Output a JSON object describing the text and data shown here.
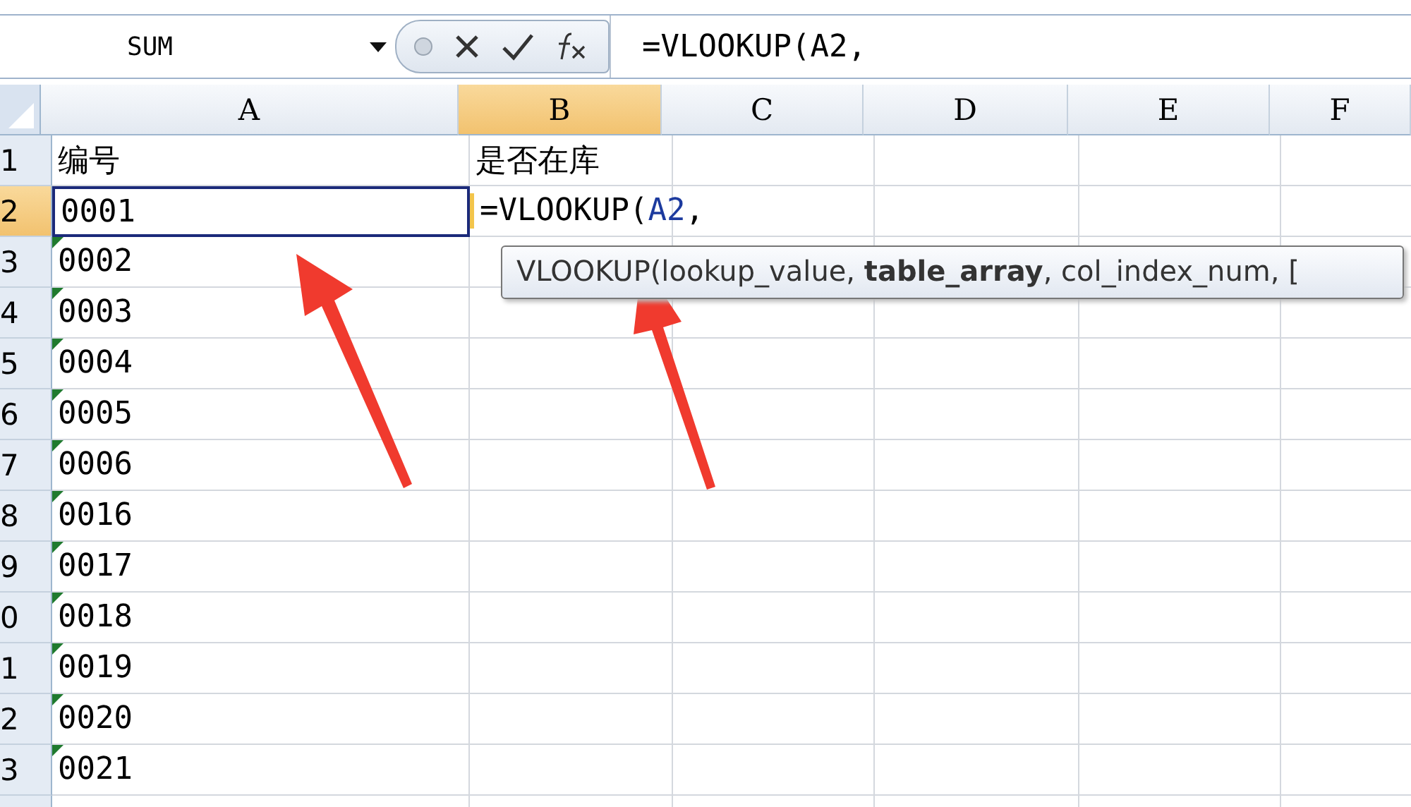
{
  "formula_bar": {
    "name_box": "SUM",
    "formula": "=VLOOKUP(A2,"
  },
  "columns": [
    {
      "label": "A",
      "selected": false
    },
    {
      "label": "B",
      "selected": true
    },
    {
      "label": "C",
      "selected": false
    },
    {
      "label": "D",
      "selected": false
    },
    {
      "label": "E",
      "selected": false
    },
    {
      "label": "F",
      "selected": false
    }
  ],
  "rows": [
    {
      "label": "1",
      "selected": false,
      "a_text": "编号",
      "a_flag": false,
      "a_referenced": false,
      "b_text": "是否在库"
    },
    {
      "label": "2",
      "selected": true,
      "a_text": "0001",
      "a_flag": false,
      "a_referenced": true,
      "b_edit": [
        {
          "text": "=VLOOKUP(",
          "kind": "plain"
        },
        {
          "text": "A2",
          "kind": "reference"
        },
        {
          "text": ",",
          "kind": "plain"
        }
      ]
    },
    {
      "label": "3",
      "selected": false,
      "a_text": "0002",
      "a_flag": true,
      "a_referenced": false
    },
    {
      "label": "4",
      "selected": false,
      "a_text": "0003",
      "a_flag": true,
      "a_referenced": false
    },
    {
      "label": "5",
      "selected": false,
      "a_text": "0004",
      "a_flag": true,
      "a_referenced": false
    },
    {
      "label": "6",
      "selected": false,
      "a_text": "0005",
      "a_flag": true,
      "a_referenced": false
    },
    {
      "label": "7",
      "selected": false,
      "a_text": "0006",
      "a_flag": true,
      "a_referenced": false
    },
    {
      "label": "8",
      "selected": false,
      "a_text": "0016",
      "a_flag": true,
      "a_referenced": false
    },
    {
      "label": "9",
      "selected": false,
      "a_text": "0017",
      "a_flag": true,
      "a_referenced": false
    },
    {
      "label": "0",
      "selected": false,
      "a_text": "0018",
      "a_flag": true,
      "a_referenced": false
    },
    {
      "label": "1",
      "selected": false,
      "a_text": "0019",
      "a_flag": true,
      "a_referenced": false
    },
    {
      "label": "2",
      "selected": false,
      "a_text": "0020",
      "a_flag": true,
      "a_referenced": false
    },
    {
      "label": "3",
      "selected": false,
      "a_text": "0021",
      "a_flag": true,
      "a_referenced": false
    }
  ],
  "tooltip": "VLOOKUP(lookup_value, **table_array**, col_index_num, ["
}
